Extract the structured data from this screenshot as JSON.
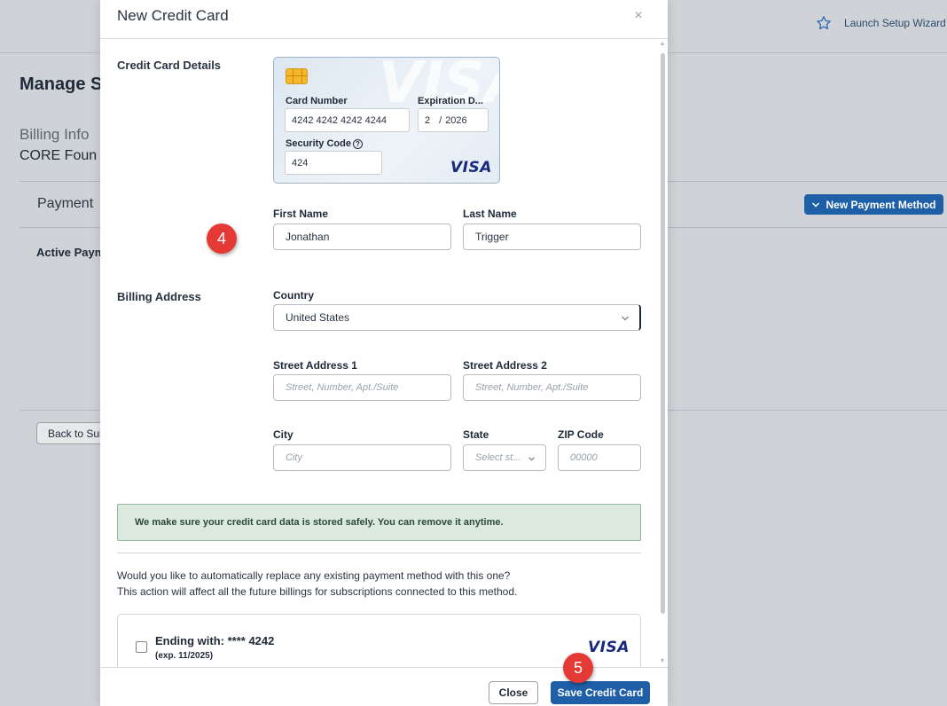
{
  "background": {
    "launch_wizard": "Launch Setup Wizard",
    "page_title": "Manage S",
    "billing_info": "Billing Info",
    "org_name": "CORE Foun",
    "payment_header": "Payment",
    "active_payment": "Active Paym",
    "new_payment_button": "New Payment Method",
    "back_button": "Back to Sub"
  },
  "modal": {
    "title": "New Credit Card",
    "close_glyph": "×",
    "credit_card_section": "Credit Card Details",
    "card": {
      "watermark": "VISA",
      "card_number_label": "Card Number",
      "card_number_value": "4242 4242 4242 4244",
      "expiration_label": "Expiration D...",
      "exp_month": "2",
      "exp_separator": "/",
      "exp_year": "2026",
      "security_label": "Security Code",
      "help_glyph": "?",
      "security_value": "424",
      "brand": "VISA"
    },
    "first_name_label": "First Name",
    "first_name_value": "Jonathan",
    "last_name_label": "Last Name",
    "last_name_value": "Trigger",
    "billing_section": "Billing Address",
    "country_label": "Country",
    "country_value": "United States",
    "street1_label": "Street Address 1",
    "street1_placeholder": "Street, Number, Apt./Suite",
    "street2_label": "Street Address 2",
    "street2_placeholder": "Street, Number, Apt./Suite",
    "city_label": "City",
    "city_placeholder": "City",
    "state_label": "State",
    "state_placeholder": "Select st...",
    "zip_label": "ZIP Code",
    "zip_placeholder": "00000",
    "notice": "We make sure your credit card data is stored safely. You can remove it anytime.",
    "question_line1": "Would you like to automatically replace any existing payment method with this one?",
    "question_line2": "This action will affect all the future billings for subscriptions connected to this method.",
    "existing_method": {
      "ending": "Ending with: **** 4242",
      "expiry": "(exp. 11/2025)",
      "brand": "VISA"
    },
    "close_button": "Close",
    "save_button": "Save Credit Card"
  },
  "step_badges": [
    "4",
    "5"
  ],
  "colors": {
    "primary": "#1f5fa8",
    "badge": "#e53935",
    "notice_bg": "#dbe9df",
    "visa_blue": "#1a2a7a"
  }
}
